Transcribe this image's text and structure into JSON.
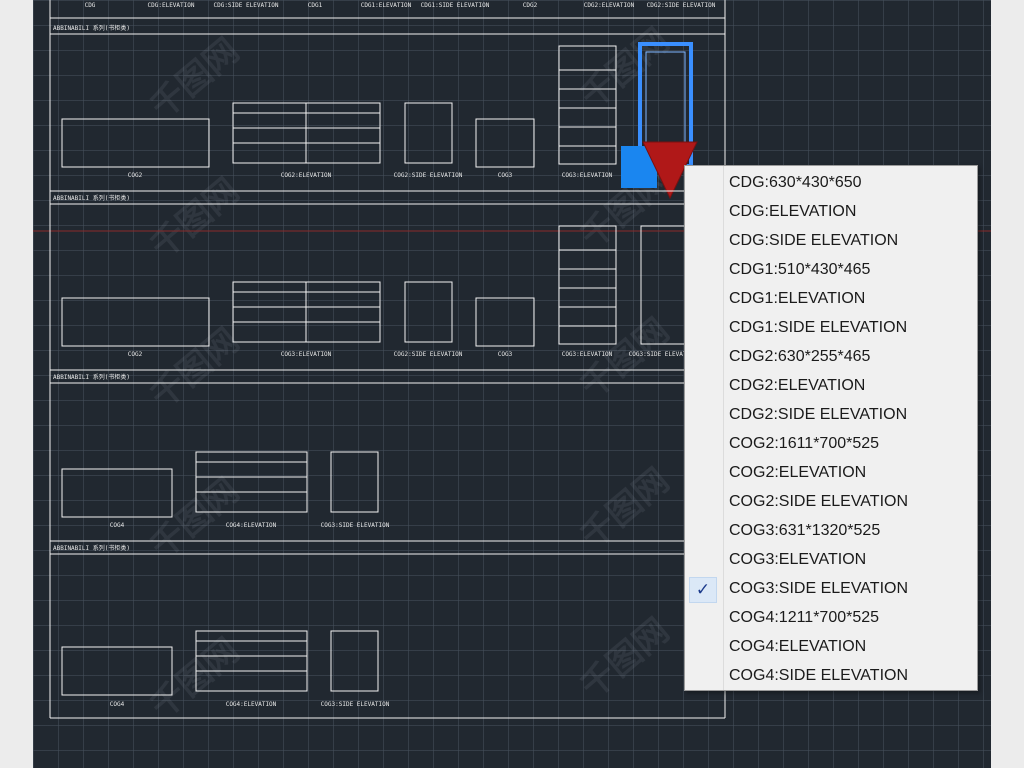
{
  "drawing": {
    "top_row_labels": [
      "CDG",
      "CDG:ELEVATION",
      "CDG:SIDE ELEVATION",
      "CDG1",
      "CDG1:ELEVATION",
      "CDG1:SIDE ELEVATION",
      "CDG2",
      "CDG2:ELEVATION",
      "CDG2:SIDE ELEVATION"
    ],
    "section_header": "ABBINABILI 系列(书柜类)",
    "sections": [
      {
        "labels": [
          "COG2",
          "COG2:ELEVATION",
          "COG2:SIDE ELEVATION",
          "COG3",
          "COG3:ELEVATION"
        ]
      },
      {
        "labels": [
          "COG2",
          "COG3:ELEVATION",
          "COG2:SIDE ELEVATION",
          "COG3",
          "COG3:ELEVATION",
          "COG3:SIDE ELEVATION"
        ]
      },
      {
        "labels": [
          "COG4",
          "COG4:ELEVATION",
          "COG3:SIDE ELEVATION"
        ]
      },
      {
        "labels": [
          "COG4",
          "COG4:ELEVATION",
          "COG3:SIDE ELEVATION"
        ]
      }
    ],
    "watermark": "千图网",
    "colors": {
      "background": "#212830",
      "selection": "#3a8fff",
      "grip": "#b01818",
      "hover_grip": "#1a86f0"
    }
  },
  "menu": {
    "items": [
      {
        "label": "CDG:630*430*650",
        "checked": false
      },
      {
        "label": "CDG:ELEVATION",
        "checked": false
      },
      {
        "label": "CDG:SIDE ELEVATION",
        "checked": false
      },
      {
        "label": "CDG1:510*430*465",
        "checked": false
      },
      {
        "label": "CDG1:ELEVATION",
        "checked": false
      },
      {
        "label": "CDG1:SIDE ELEVATION",
        "checked": false
      },
      {
        "label": "CDG2:630*255*465",
        "checked": false
      },
      {
        "label": "CDG2:ELEVATION",
        "checked": false
      },
      {
        "label": "CDG2:SIDE ELEVATION",
        "checked": false
      },
      {
        "label": "COG2:1611*700*525",
        "checked": false
      },
      {
        "label": "COG2:ELEVATION",
        "checked": false
      },
      {
        "label": "COG2:SIDE ELEVATION",
        "checked": false
      },
      {
        "label": "COG3:631*1320*525",
        "checked": false
      },
      {
        "label": "COG3:ELEVATION",
        "checked": false
      },
      {
        "label": "COG3:SIDE ELEVATION",
        "checked": true
      },
      {
        "label": "COG4:1211*700*525",
        "checked": false
      },
      {
        "label": "COG4:ELEVATION",
        "checked": false
      },
      {
        "label": "COG4:SIDE ELEVATION",
        "checked": false
      }
    ],
    "check_glyph": "✓"
  }
}
